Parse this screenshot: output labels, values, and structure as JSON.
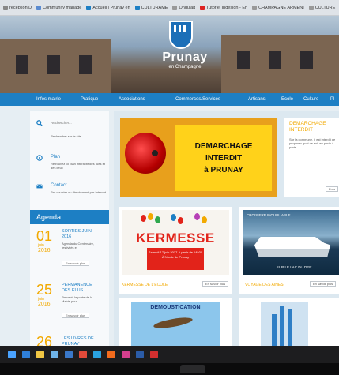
{
  "bookmarks": [
    {
      "label": "réception D",
      "color": "#888888"
    },
    {
      "label": "Community manage",
      "color": "#5b8bd0"
    },
    {
      "label": "Accueil | Prunay en",
      "color": "#1d7fc4"
    },
    {
      "label": "CULTURAME",
      "color": "#1d7fc4"
    },
    {
      "label": "Ondulait",
      "color": "#999999"
    },
    {
      "label": "Tutoriel Indesign - En",
      "color": "#d22"
    },
    {
      "label": "CHAMPAGNE ARMENI",
      "color": "#999999"
    },
    {
      "label": "CULTURE",
      "color": "#999999"
    }
  ],
  "site": {
    "name": "Prunay",
    "subtitle": "en Champagne"
  },
  "nav": [
    "Infos mairie",
    "Pratique",
    "Associations",
    "Commerces/Services",
    "Artisans",
    "Ecole",
    "Culture",
    "Pl"
  ],
  "sidebar": {
    "search": {
      "placeholder": "Rechercher...",
      "desc": "Rechercher sur le site"
    },
    "plan": {
      "title": "Plan",
      "desc": "Retrouvez ici plan interactif des rues et des lieux"
    },
    "contact": {
      "title": "Contact",
      "desc": "Par courrier ou directement par Internet"
    }
  },
  "agenda": {
    "title": "Agenda",
    "button_label": "En savoir plus",
    "events": [
      {
        "day": "01",
        "month": "juin",
        "year": "2016",
        "title": "SORTIES JUIN 2016",
        "desc": "Agenda du Centenaire, festivités et"
      },
      {
        "day": "25",
        "month": "juin",
        "year": "2016",
        "title": "PERMANENCE DES ELUS",
        "desc": "Prévenir la porte de la Mairie pour"
      },
      {
        "day": "26",
        "month": "",
        "year": "",
        "title": "LES LIVRES DE PRUNAY",
        "desc": ""
      }
    ]
  },
  "main": {
    "demarchage": {
      "sign_lines": [
        "DEMARCHAGE",
        "INTERDIT",
        "à PRUNAY"
      ],
      "heading": "DEMARCHAGE INTERDIT",
      "body": "Sur la commune, il est interdit de proposer quoi ce soit en porte à porte",
      "button": "En s"
    },
    "kermesse": {
      "word": "KERMESSE",
      "note": "Samedi 17 juin 2017 À partir de 14h30 À l'école de Prunay",
      "caption": "KERMESSE DE L'ECOLE",
      "button": "En savoir plus"
    },
    "cruise": {
      "overlay": "CROISIERE INOUBLIABLE",
      "tag": "...SUR LE LAC DU DER",
      "caption": "VOYAGE DES AINES",
      "button": "En savoir plus"
    },
    "demo": {
      "title": "DEMOUSTICATION"
    }
  },
  "colors": {
    "brand_blue": "#1d7fc4",
    "accent_orange": "#f2a900",
    "sign_yellow": "#ffd21a",
    "kermesse_red": "#e2231a"
  },
  "taskbar_icons": [
    "windows-icon",
    "edge-icon",
    "explorer-icon",
    "store-icon",
    "mail-icon",
    "chrome-icon",
    "photoshop-icon",
    "firefox-icon",
    "indesign-icon",
    "word-icon",
    "acrobat-icon"
  ]
}
